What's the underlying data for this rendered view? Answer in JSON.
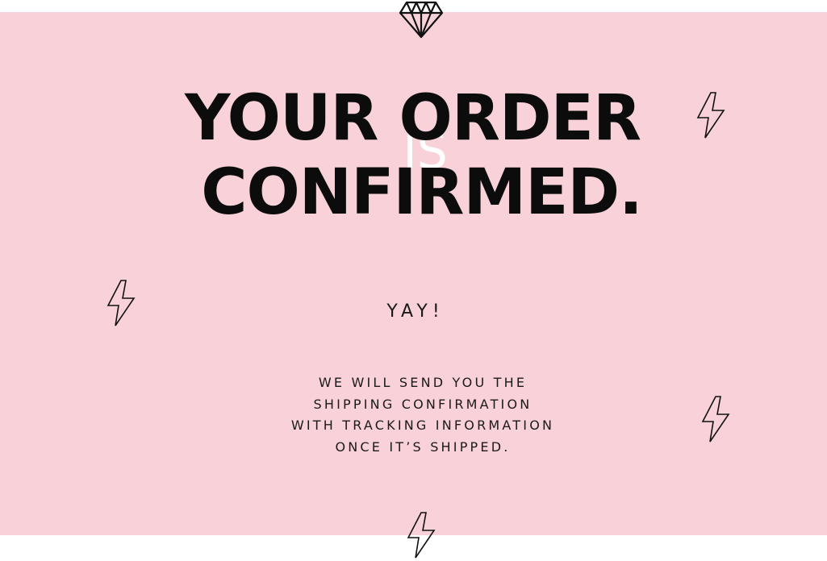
{
  "colors": {
    "banner_background": "#f9d2d9",
    "page_background": "#ffffff",
    "text_primary": "#0c0c0c",
    "is_word": "#ffffff"
  },
  "icons": {
    "top": "diamond-icon",
    "decorations": [
      "lightning-bolt-icon",
      "lightning-bolt-icon",
      "lightning-bolt-icon",
      "lightning-bolt-icon"
    ]
  },
  "headline": {
    "line1": "YOUR ORDER",
    "connector": "IS",
    "line2": "CONFIRMED."
  },
  "exclamation": "YAY!",
  "message": {
    "lines": [
      "WE WILL SEND YOU THE",
      "SHIPPING CONFIRMATION",
      "WITH TRACKING INFORMATION",
      "ONCE IT’S SHIPPED."
    ]
  }
}
